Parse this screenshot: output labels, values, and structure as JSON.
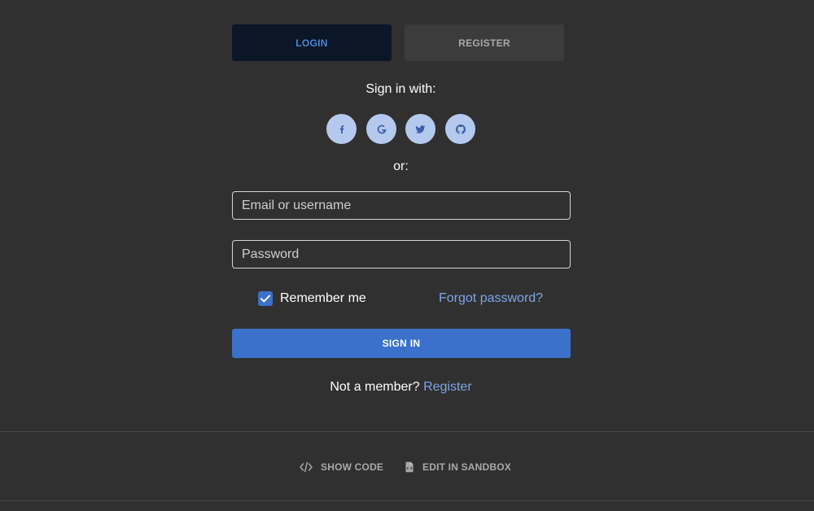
{
  "tabs": {
    "login_label": "LOGIN",
    "register_label": "REGISTER",
    "active": "login"
  },
  "social": {
    "heading": "Sign in with:",
    "buttons": [
      {
        "icon": "facebook-icon"
      },
      {
        "icon": "google-icon"
      },
      {
        "icon": "twitter-icon"
      },
      {
        "icon": "github-icon"
      }
    ]
  },
  "divider_text": "or:",
  "form": {
    "email_placeholder": "Email or username",
    "email_value": "",
    "password_placeholder": "Password",
    "password_value": "",
    "remember_label": "Remember me",
    "remember_checked": true,
    "forgot_label": "Forgot password?",
    "submit_label": "SIGN IN"
  },
  "member": {
    "prompt": "Not a member?",
    "register_label": "Register"
  },
  "footer": {
    "show_code_label": "SHOW CODE",
    "edit_sandbox_label": "EDIT IN SANDBOX"
  },
  "colors": {
    "background": "#303030",
    "accent": "#3b71ca",
    "link": "#7da6e8",
    "social_button": "#b5c9ef",
    "active_tab_bg": "#0b1627"
  }
}
